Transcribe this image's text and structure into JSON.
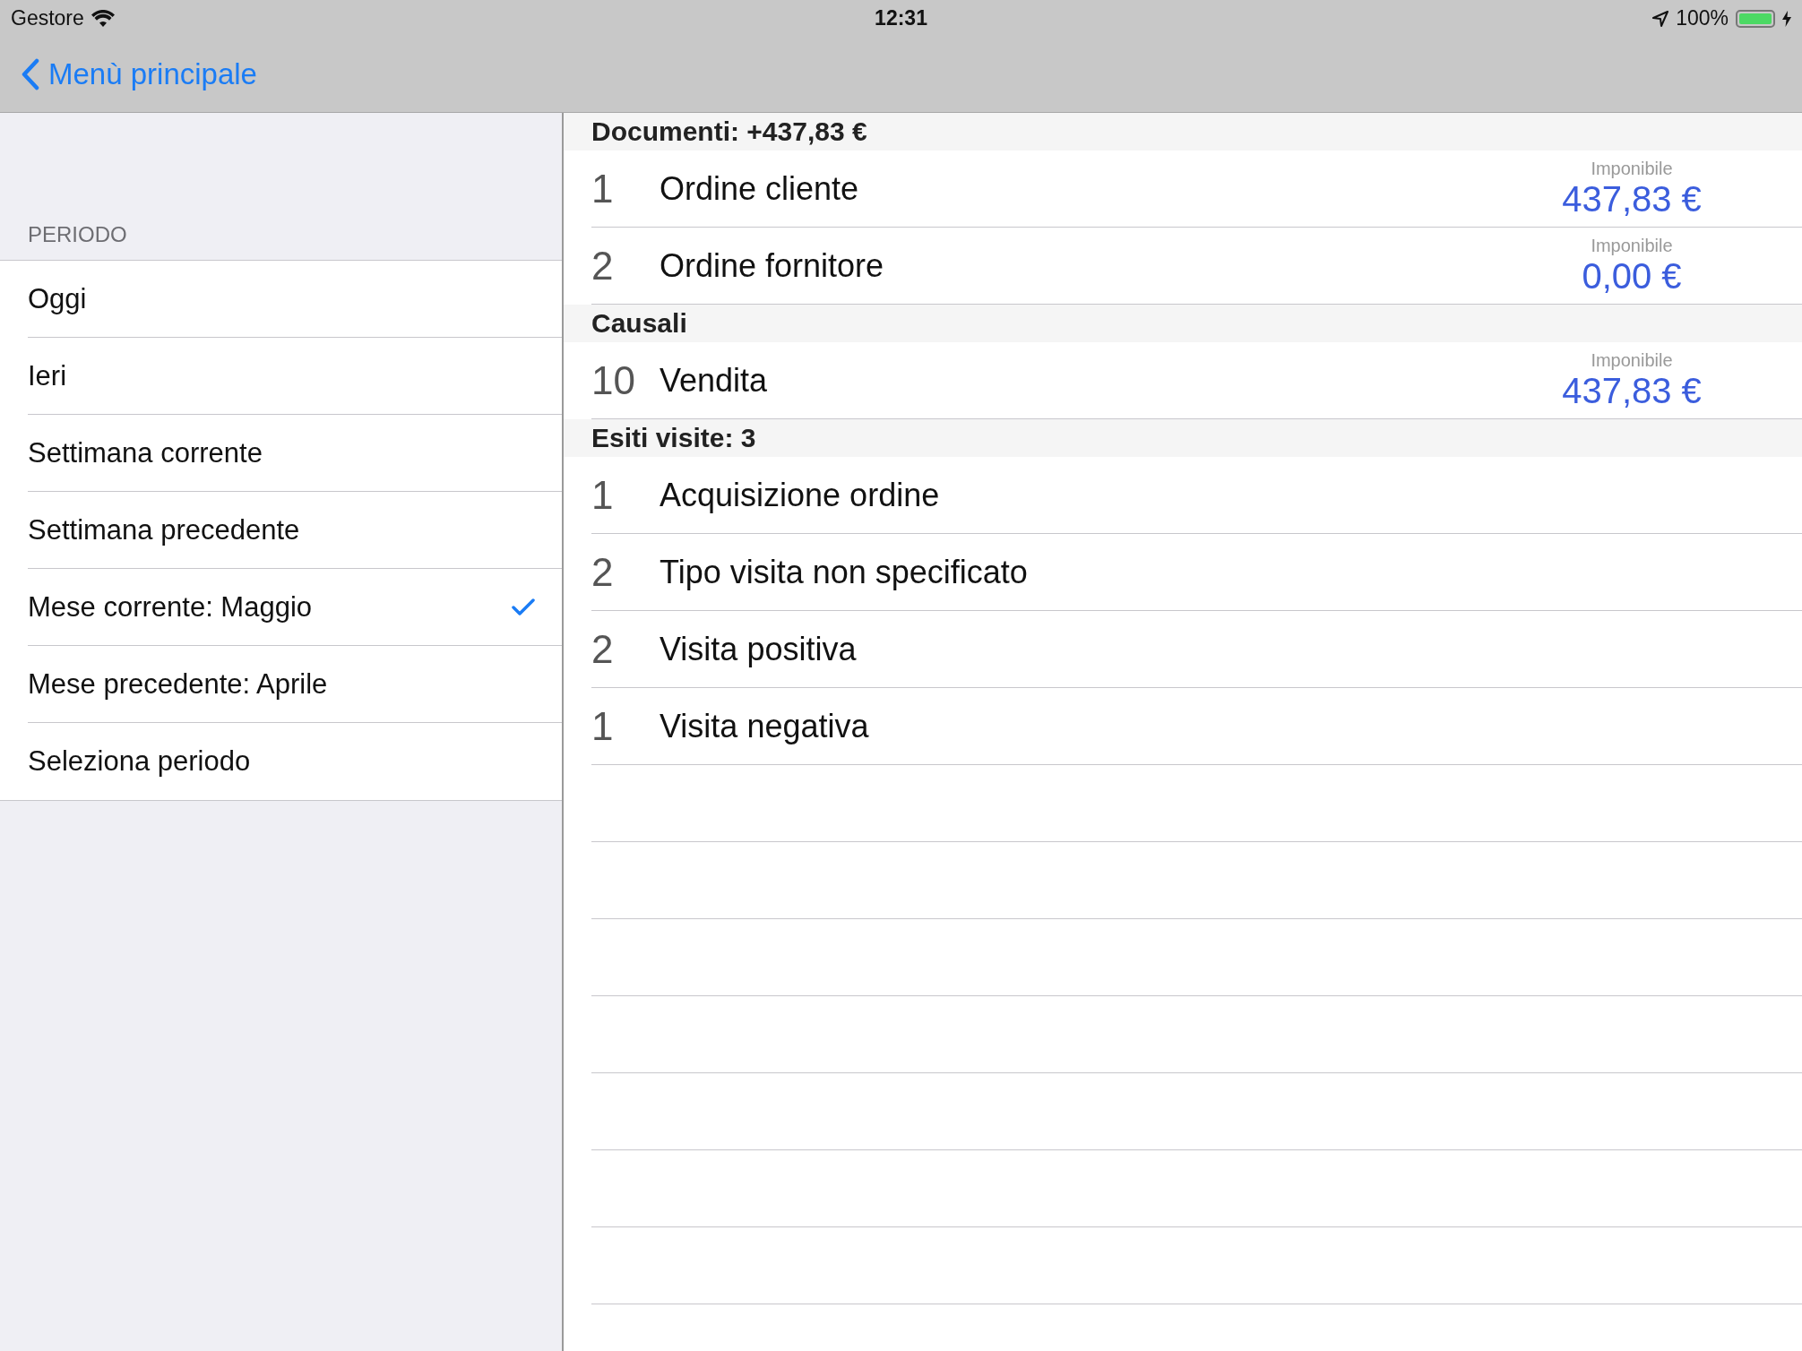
{
  "status_bar": {
    "carrier": "Gestore",
    "time": "12:31",
    "battery": "100%"
  },
  "nav_bar": {
    "back_label": "Menù principale"
  },
  "sidebar": {
    "section_title": "PERIODO",
    "items": [
      {
        "label": "Oggi",
        "selected": false
      },
      {
        "label": "Ieri",
        "selected": false
      },
      {
        "label": "Settimana corrente",
        "selected": false
      },
      {
        "label": "Settimana precedente",
        "selected": false
      },
      {
        "label": "Mese corrente: Maggio",
        "selected": true
      },
      {
        "label": "Mese precedente: Aprile",
        "selected": false
      },
      {
        "label": "Seleziona periodo",
        "selected": false
      }
    ]
  },
  "sections": [
    {
      "title": "Documenti: +437,83 €",
      "rows": [
        {
          "number": "1",
          "label": "Ordine cliente",
          "amount_label": "Imponibile",
          "amount": "437,83 €"
        },
        {
          "number": "2",
          "label": "Ordine fornitore",
          "amount_label": "Imponibile",
          "amount": "0,00 €"
        }
      ]
    },
    {
      "title": "Causali",
      "rows": [
        {
          "number": "10",
          "label": "Vendita",
          "amount_label": "Imponibile",
          "amount": "437,83 €"
        }
      ]
    },
    {
      "title": "Esiti visite: 3",
      "rows": [
        {
          "number": "1",
          "label": "Acquisizione ordine"
        },
        {
          "number": "2",
          "label": "Tipo visita non specificato"
        },
        {
          "number": "2",
          "label": "Visita positiva"
        },
        {
          "number": "1",
          "label": "Visita negativa"
        }
      ]
    }
  ]
}
